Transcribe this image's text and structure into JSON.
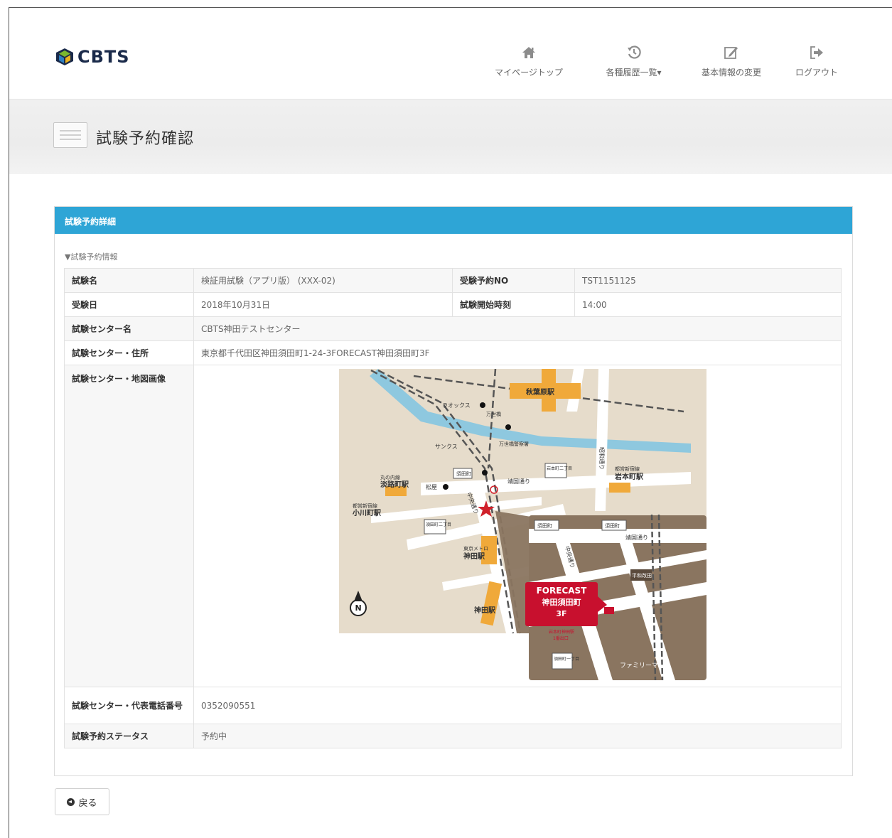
{
  "header": {
    "logo_text": "CBTS",
    "nav": [
      {
        "label": "マイページトップ",
        "icon": "home-icon"
      },
      {
        "label": "各種履歴一覧▾",
        "icon": "history-icon"
      },
      {
        "label": "基本情報の変更",
        "icon": "edit-icon"
      },
      {
        "label": "ログアウト",
        "icon": "logout-icon"
      }
    ]
  },
  "page": {
    "title": "試験予約確認"
  },
  "panel": {
    "heading": "試験予約詳細",
    "section_label": "▼試験予約情報",
    "rows": {
      "exam_name_label": "試験名",
      "exam_name": "検証用試験（アプリ版） (XXX-02)",
      "reservation_no_label": "受験予約NO",
      "reservation_no": "TST1151125",
      "exam_date_label": "受験日",
      "exam_date": "2018年10月31日",
      "start_time_label": "試験開始時刻",
      "start_time": "14:00",
      "center_name_label": "試験センター名",
      "center_name": "CBTS神田テストセンター",
      "center_address_label": "試験センター・住所",
      "center_address": "東京都千代田区神田須田町1-24-3FORECAST神田須田町3F",
      "center_map_label": "試験センター・地図画像",
      "center_phone_label": "試験センター・代表電話番号",
      "center_phone": "0352090551",
      "status_label": "試験予約ステータス",
      "status": "予約中"
    }
  },
  "map": {
    "stations": [
      "秋葉原駅",
      "淡路町駅",
      "小川町駅",
      "岩本町駅",
      "神田駅",
      "神田駅"
    ],
    "station_lines": [
      "丸の内線",
      "都営新宿線",
      "都営新宿線",
      "東京メトロ"
    ],
    "landmarks": [
      "ラオックス",
      "サンクス",
      "松屋",
      "万世橋",
      "万世橋警察署"
    ],
    "streets": [
      "靖国通り",
      "中央通り",
      "昭和通り",
      "ファミリーマート"
    ],
    "signals": [
      "須田町",
      "須田町",
      "須田町",
      "岩本町二丁目",
      "須田町二丁目",
      "須田町一丁目",
      "平和改田"
    ],
    "building": [
      "FORECAST",
      "神田須田町",
      "3F"
    ],
    "exit_note": [
      "岩本町神田駅",
      "1番出口"
    ],
    "north": "N"
  },
  "footer": {
    "back_label": "戻る"
  },
  "colors": {
    "accent": "#2ea5d6",
    "map_station": "#f0a93a",
    "map_river": "#7fc3dc",
    "map_inset": "#8a7560",
    "map_building": "#c8102e"
  }
}
